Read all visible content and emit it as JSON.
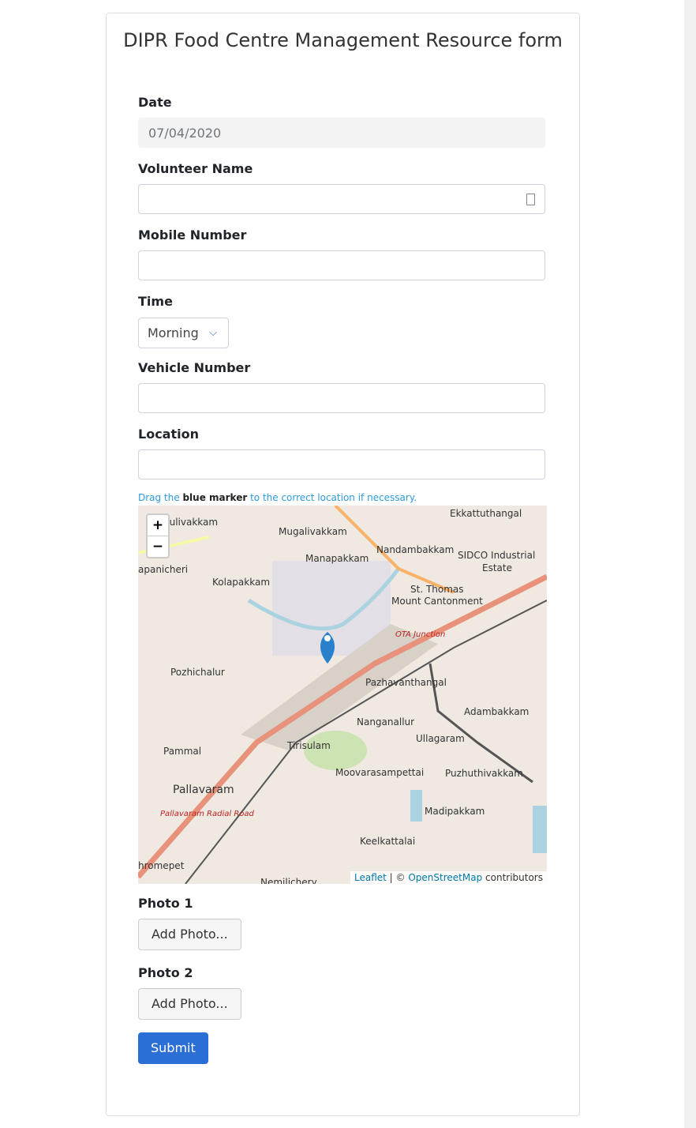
{
  "title": "DIPR Food Centre Management Resource form",
  "fields": {
    "date_label": "Date",
    "date_value": "07/04/2020",
    "volunteer_label": "Volunteer Name",
    "mobile_label": "Mobile Number",
    "time_label": "Time",
    "time_value": "Morning",
    "vehicle_label": "Vehicle Number",
    "location_label": "Location"
  },
  "map": {
    "hint_pre": "Drag the ",
    "hint_bold": "blue marker",
    "hint_post": " to the correct location if necessary.",
    "zoom_in": "+",
    "zoom_out": "−",
    "attribution_leaflet": "Leaflet",
    "attribution_sep": " | © ",
    "attribution_osm": "OpenStreetMap",
    "attribution_post": " contributors",
    "places": [
      "Ekkattuthangal",
      "Mugalivakkam",
      "Nandambakkam",
      "SIDCO Industrial",
      "Estate",
      "Manapakkam",
      "Kolapakkam",
      "St. Thomas",
      "Mount Cantonment",
      "OTA Junction",
      "Pozhichalur",
      "Pazhavanthangal",
      "Adambakkam",
      "Nanganallur",
      "Ullagaram",
      "Tirisulam",
      "Pammal",
      "Moovarasampettai",
      "Puzhuthivakkam",
      "Pallavaram",
      "Madipakkam",
      "Keelkattalai",
      "Pallavaram Radial Road",
      "Nemilichery",
      "hromepet",
      "pulivakkam",
      "apanicheri"
    ]
  },
  "photo1_label": "Photo 1",
  "photo2_label": "Photo 2",
  "add_photo": "Add Photo...",
  "submit": "Submit"
}
